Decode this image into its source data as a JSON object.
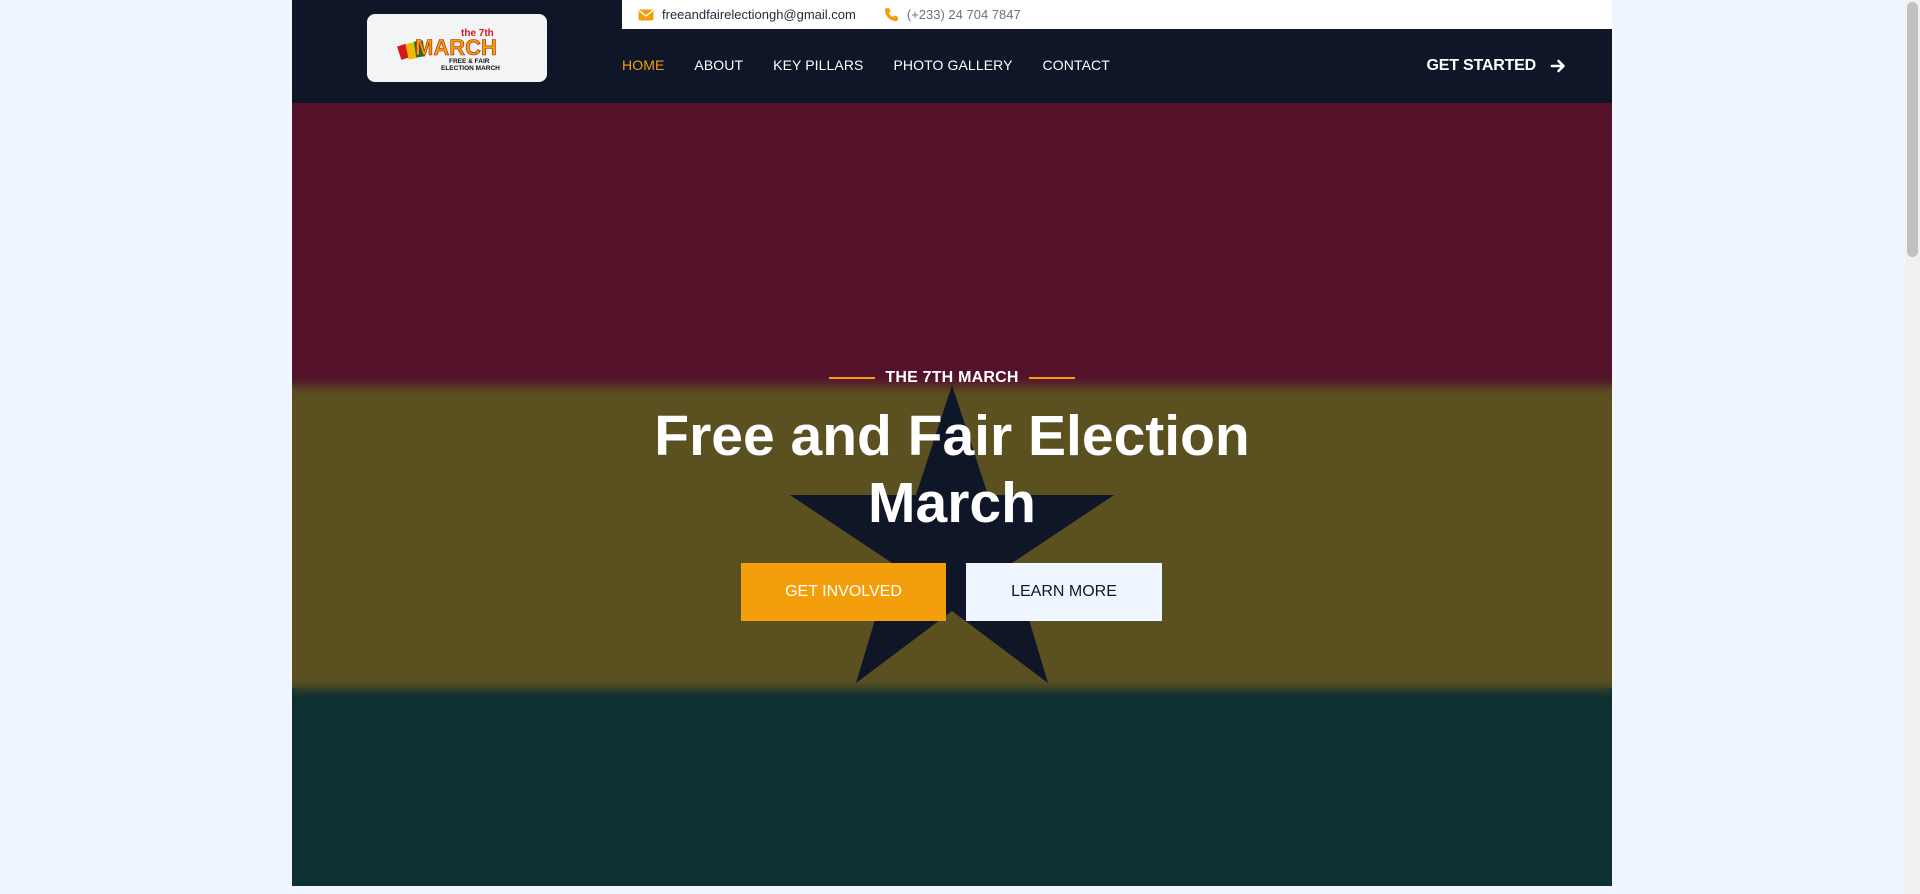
{
  "header": {
    "logo": {
      "text_top": "the 7th",
      "text_main": "MARCH",
      "text_sub1": "FREE & FAIR",
      "text_sub2": "ELECTION MARCH"
    },
    "topbar": {
      "email": "freeandfairelectiongh@gmail.com",
      "phone": "(+233) 24 704 7847"
    },
    "nav": [
      {
        "label": "HOME",
        "active": true
      },
      {
        "label": "ABOUT"
      },
      {
        "label": "KEY PILLARS"
      },
      {
        "label": "PHOTO GALLERY"
      },
      {
        "label": "CONTACT"
      }
    ],
    "cta": "GET STARTED"
  },
  "hero": {
    "eyebrow": "THE 7TH MARCH",
    "title": "Free and Fair Election March",
    "primary_button": "GET INVOLVED",
    "secondary_button": "LEARN MORE"
  },
  "colors": {
    "accent": "#f59e0b",
    "navy": "#0e1628",
    "flag_red": "#54122a",
    "flag_gold": "#5a5020",
    "flag_green": "#0d3030"
  },
  "icons": {
    "email": "envelope-icon",
    "phone": "phone-icon",
    "cta": "arrow-right-icon"
  }
}
